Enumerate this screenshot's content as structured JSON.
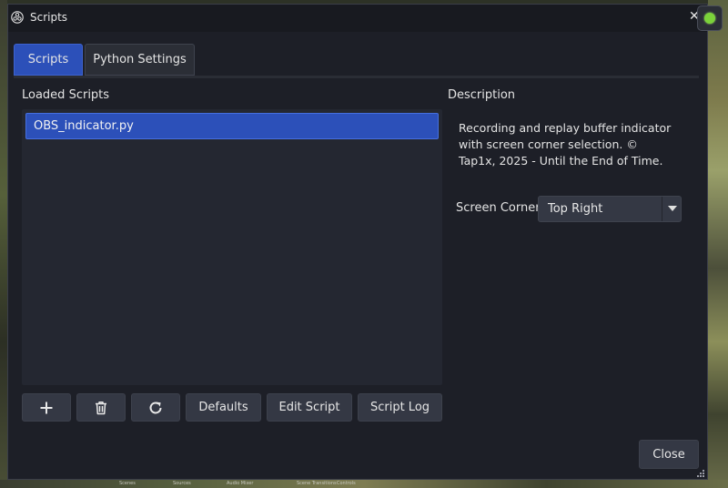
{
  "window": {
    "title": "Scripts",
    "close_glyph": "✕"
  },
  "tabs": [
    {
      "label": "Scripts",
      "active": true
    },
    {
      "label": "Python Settings",
      "active": false
    }
  ],
  "loaded_scripts": {
    "label": "Loaded Scripts",
    "items": [
      "OBS_indicator.py"
    ],
    "selected_index": 0
  },
  "toolbar": {
    "add_icon": "plus-icon",
    "remove_icon": "trash-icon",
    "reload_icon": "reload-icon",
    "defaults_label": "Defaults",
    "edit_label": "Edit Script",
    "log_label": "Script Log"
  },
  "description": {
    "label": "Description",
    "text": "Recording and replay buffer indicator with screen corner selection. © Tap1x, 2025 - Until the End of Time."
  },
  "settings": {
    "screen_corner_label": "Screen Corner",
    "screen_corner_value": "Top Right"
  },
  "footer": {
    "close_label": "Close"
  },
  "taskbar": [
    "Scenes",
    "Sources",
    "Audio Mixer",
    "Scene Transitions",
    "Controls"
  ],
  "colors": {
    "accent": "#2c50b9",
    "background": "#1d1f27",
    "indicator": "#7bd23a"
  }
}
